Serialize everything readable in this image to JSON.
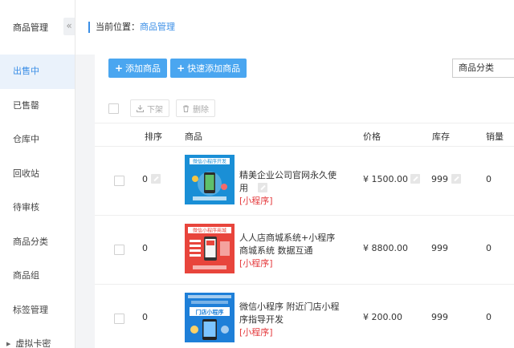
{
  "sidebar": {
    "title": "商品管理",
    "collapse_icon": "«",
    "items": [
      {
        "label": "出售中",
        "active": true
      },
      {
        "label": "已售罄"
      },
      {
        "label": "仓库中"
      },
      {
        "label": "回收站"
      },
      {
        "label": "待审核"
      },
      {
        "label": "商品分类"
      },
      {
        "label": "商品组"
      },
      {
        "label": "标签管理"
      },
      {
        "label": "虚拟卡密"
      }
    ]
  },
  "breadcrumb": {
    "label": "当前位置：",
    "current": "商品管理"
  },
  "toolbar": {
    "add_label": "添加商品",
    "quick_add_label": "快速添加商品",
    "category_select": "商品分类"
  },
  "bulk": {
    "offline_label": "下架",
    "delete_label": "删除"
  },
  "table": {
    "headers": {
      "sort": "排序",
      "product": "商品",
      "price": "价格",
      "stock": "库存",
      "sales": "销量"
    },
    "rows": [
      {
        "sort": "0",
        "title": "精美企业公司官网永久使用",
        "tag": "[小程序]",
        "price": "¥ 1500.00",
        "stock": "999",
        "sales": "0",
        "thumb_text": "微信小程序开发"
      },
      {
        "sort": "0",
        "title": "人人店商城系统+小程序商城系统 数据互通",
        "tag": "[小程序]",
        "price": "¥ 8800.00",
        "stock": "999",
        "sales": "0",
        "thumb_text": "微信小程序商城"
      },
      {
        "sort": "0",
        "title": "微信小程序 附近门店小程序指导开发",
        "tag": "[小程序]",
        "price": "¥ 200.00",
        "stock": "999",
        "sales": "0",
        "thumb_text": "门店小程序"
      }
    ]
  }
}
